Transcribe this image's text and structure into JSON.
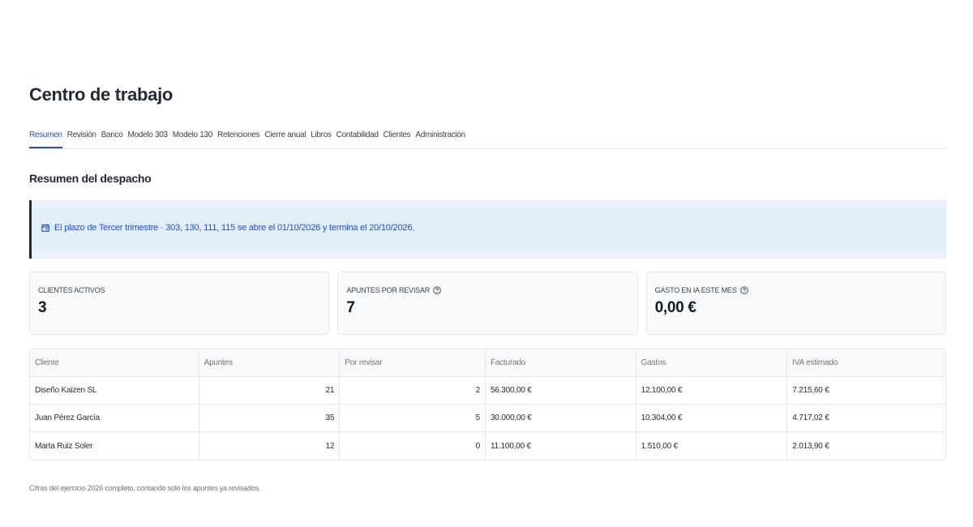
{
  "header": {
    "title": "Centro de trabajo"
  },
  "tabs": [
    {
      "label": "Resumen"
    },
    {
      "label": "Revisión"
    },
    {
      "label": "Banco"
    },
    {
      "label": "Modelo 303"
    },
    {
      "label": "Modelo 130"
    },
    {
      "label": "Retenciones"
    },
    {
      "label": "Cierre anual"
    },
    {
      "label": "Libros"
    },
    {
      "label": "Contabilidad"
    },
    {
      "label": "Clientes"
    },
    {
      "label": "Administración"
    }
  ],
  "section": {
    "title": "Resumen del despacho"
  },
  "notice": {
    "icon": "calendar-icon",
    "text": "El plazo de Tercer trimestre · 303, 130, 111, 115 se abre el 01/10/2026 y termina el 20/10/2026."
  },
  "cards": [
    {
      "label": "CLIENTES ACTIVOS",
      "value": "3"
    },
    {
      "label": "APUNTES POR REVISAR",
      "value": "7"
    },
    {
      "label": "GASTO EN IA ESTE MES",
      "value": "0,00 €"
    }
  ],
  "table": {
    "columns": [
      "Cliente",
      "Apuntes",
      "Por revisar",
      "Facturado",
      "Gastos",
      "IVA estimado"
    ],
    "rows": [
      [
        "Diseño Kaizen SL",
        "21",
        "2",
        "56.300,00 €",
        "12.100,00 €",
        "7.215,60 €"
      ],
      [
        "Juan Pérez García",
        "35",
        "5",
        "30.000,00 €",
        "10.304,00 €",
        "4.717,02 €"
      ],
      [
        "Marta Ruiz Soler",
        "12",
        "0",
        "11.100,00 €",
        "1.510,00 €",
        "2.013,90 €"
      ]
    ]
  },
  "footnote": "Cifras del ejercicio 2026 completo, contando solo los apuntes ya revisados.",
  "colors": {
    "accent": "#1d4ed8",
    "notice_bg": "#e3eefb"
  }
}
